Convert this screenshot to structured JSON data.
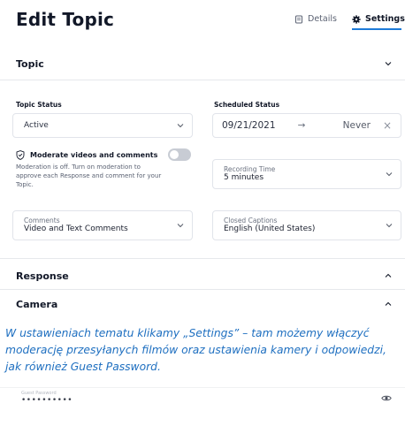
{
  "header": {
    "title": "Edit Topic",
    "tab_details": "Details",
    "tab_settings": "Settings"
  },
  "sections": {
    "topic": "Topic",
    "response": "Response",
    "camera": "Camera"
  },
  "topic_status": {
    "label": "Topic Status",
    "value": "Active"
  },
  "scheduled_status": {
    "label": "Scheduled Status",
    "start": "09/21/2021",
    "arrow": "→",
    "end": "Never",
    "clear": "×"
  },
  "moderation": {
    "title": "Moderate videos and comments",
    "description": "Moderation is off. Turn on moderation to approve each Response and comment for your Topic.",
    "enabled": false
  },
  "recording_time": {
    "label": "Recording Time",
    "value": "5 minutes"
  },
  "comments": {
    "label": "Comments",
    "value": "Video and Text Comments"
  },
  "closed_captions": {
    "label": "Closed Captions",
    "value": "English (United States)"
  },
  "caption_text": "W ustawieniach tematu klikamy „Settings” – tam możemy włączyć moderację przesyłanych filmów oraz ustawienia kamery i odpowiedzi, jak również Guest Password.",
  "guest_password": {
    "label": "Guest Password",
    "value": "••••••••••"
  },
  "colors": {
    "accent": "#1d7bd8",
    "caption": "#1e6fc0",
    "toggle_off": "#c8ccd4"
  }
}
